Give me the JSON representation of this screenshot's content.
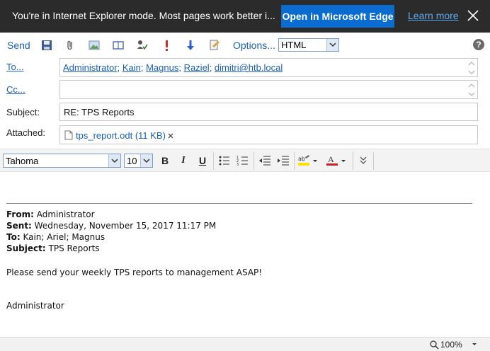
{
  "ie_banner": {
    "message": "You're in Internet Explorer mode. Most pages work better i...",
    "open_edge_label": "Open in Microsoft Edge",
    "learn_more_label": "Learn more"
  },
  "toolbar": {
    "send_label": "Send",
    "options_label": "Options...",
    "format_value": "HTML",
    "help_label": "?"
  },
  "fields": {
    "to_label": "To...",
    "cc_label": "Cc...",
    "subject_label": "Subject:",
    "attached_label": "Attached:",
    "recipients": [
      "Administrator",
      "Kain",
      "Magnus",
      "Raziel",
      "dimitri@htb.local"
    ],
    "subject_value": "RE: TPS Reports",
    "attachment": "tps_report.odt (11 KB)"
  },
  "format_bar": {
    "font_value": "Tahoma",
    "size_value": "10",
    "bold": "B",
    "italic": "I",
    "underline": "U"
  },
  "message": {
    "from_label": "From:",
    "from_value": " Administrator",
    "sent_label": "Sent:",
    "sent_value": " Wednesday, November 15, 2017 11:17 PM",
    "to_label": "To:",
    "to_value": " Kain; Ariel; Magnus",
    "subject_label": "Subject:",
    "subject_value": " TPS Reports",
    "body": "Please send your weekly TPS reports to management ASAP!",
    "signature": "Administrator"
  },
  "status": {
    "zoom": "100%"
  }
}
